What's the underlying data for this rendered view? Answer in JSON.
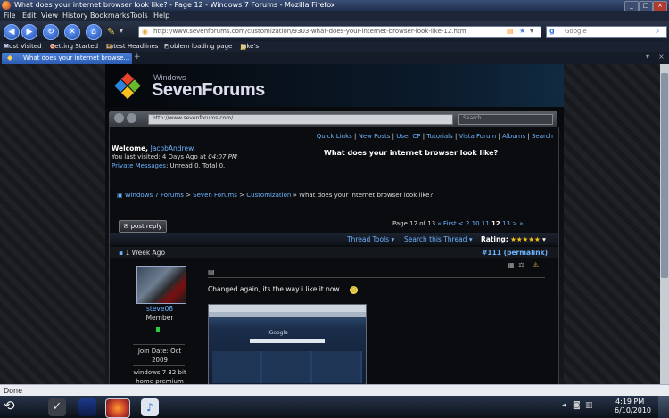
{
  "window": {
    "title": "What does your internet browser look like? - Page 12 - Windows 7 Forums - Mozilla Firefox"
  },
  "menu": [
    "File",
    "Edit",
    "View",
    "History",
    "Bookmarks",
    "Tools",
    "Help"
  ],
  "nav": {
    "url": "http://www.sevenforums.com/customization/9303-what-does-your-internet-browser-look-like-12.html",
    "search_placeholder": "Google"
  },
  "bookmarks": [
    "Most Visited",
    "Getting Started",
    "Latest Headlines",
    "Problem loading page",
    "Jake's"
  ],
  "tabs": [
    {
      "label": "What does your internet browse..."
    }
  ],
  "site": {
    "logo_small": "Windows",
    "logo_big": "SevenForums",
    "mini_url": "http://www.sevenforums.com/",
    "mini_search": "Search",
    "quick_links": [
      "Quick Links",
      "New Posts",
      "User CP",
      "Tutorials",
      "Vista Forum",
      "Albums",
      "Search"
    ],
    "welcome_prefix": "Welcome, ",
    "username": "JacobAndrew",
    "last_visited": "You last visited: 4 Days Ago at",
    "last_visited_time": "04:07 PM",
    "private_messages_label": "Private Messages",
    "private_messages_value": ": Unread 0, Total 0.",
    "thread_title": "What does your internet browser look like?",
    "breadcrumb": [
      "Windows 7 Forums",
      "Seven Forums",
      "Customization",
      "What does your internet browser look like?"
    ],
    "post_reply": "post reply",
    "page_of": "Page 12 of 13",
    "pages": [
      "« First",
      "<",
      "2",
      "10",
      "11",
      "12",
      "13",
      ">",
      "»"
    ],
    "thread_tools": "Thread Tools",
    "search_thread": "Search this Thread",
    "rating_label": "Rating:",
    "rating_stars": "★★★★★",
    "post_date": "1 Week Ago",
    "post_number": "#111",
    "permalink": "(permalink)",
    "poster_name": "steve08",
    "poster_role": "Member",
    "join_date": "Join Date: Oct 2009",
    "os": "windows 7 32 bit home premium",
    "post_text": "Changed again, its the way i like it now....",
    "screenshot_label": "iGoogle"
  },
  "status": {
    "text": "Done"
  },
  "clock": {
    "time": "4:19 PM",
    "date": "6/10/2010"
  },
  "colors": {
    "link": "#6cb4ff",
    "accent": "#3e6fc4"
  }
}
